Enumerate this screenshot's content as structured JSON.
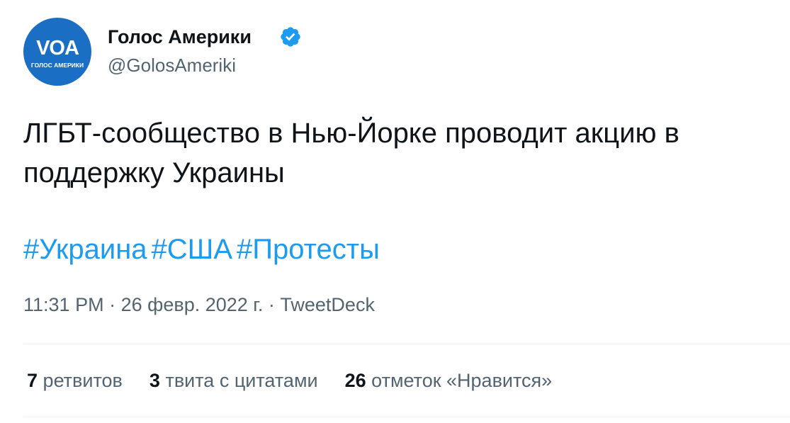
{
  "account": {
    "avatar_logo": "VOA",
    "avatar_subtitle": "ГОЛОС АМЕРИКИ",
    "display_name": "Голос Америки",
    "handle": "@GolosAmeriki",
    "verified": true,
    "verified_icon": "verified-badge-icon",
    "avatar_color": "#1a6fc4"
  },
  "tweet": {
    "text": "ЛГБТ-сообщество в Нью-Йорке проводит акцию в поддержку Украины",
    "hashtags": [
      "#Украина",
      "#США",
      "#Протесты"
    ],
    "time": "11:31 PM",
    "separator": "·",
    "date": "26 февр. 2022 г.",
    "source": "TweetDeck"
  },
  "stats": {
    "retweets_count": "7",
    "retweets_label": "ретвитов",
    "quotes_count": "3",
    "quotes_label": "твита с цитатами",
    "likes_count": "26",
    "likes_label": "отметок «Нравится»"
  },
  "colors": {
    "link": "#1d9bf0",
    "secondary_text": "#536471",
    "primary_text": "#0f1419"
  }
}
